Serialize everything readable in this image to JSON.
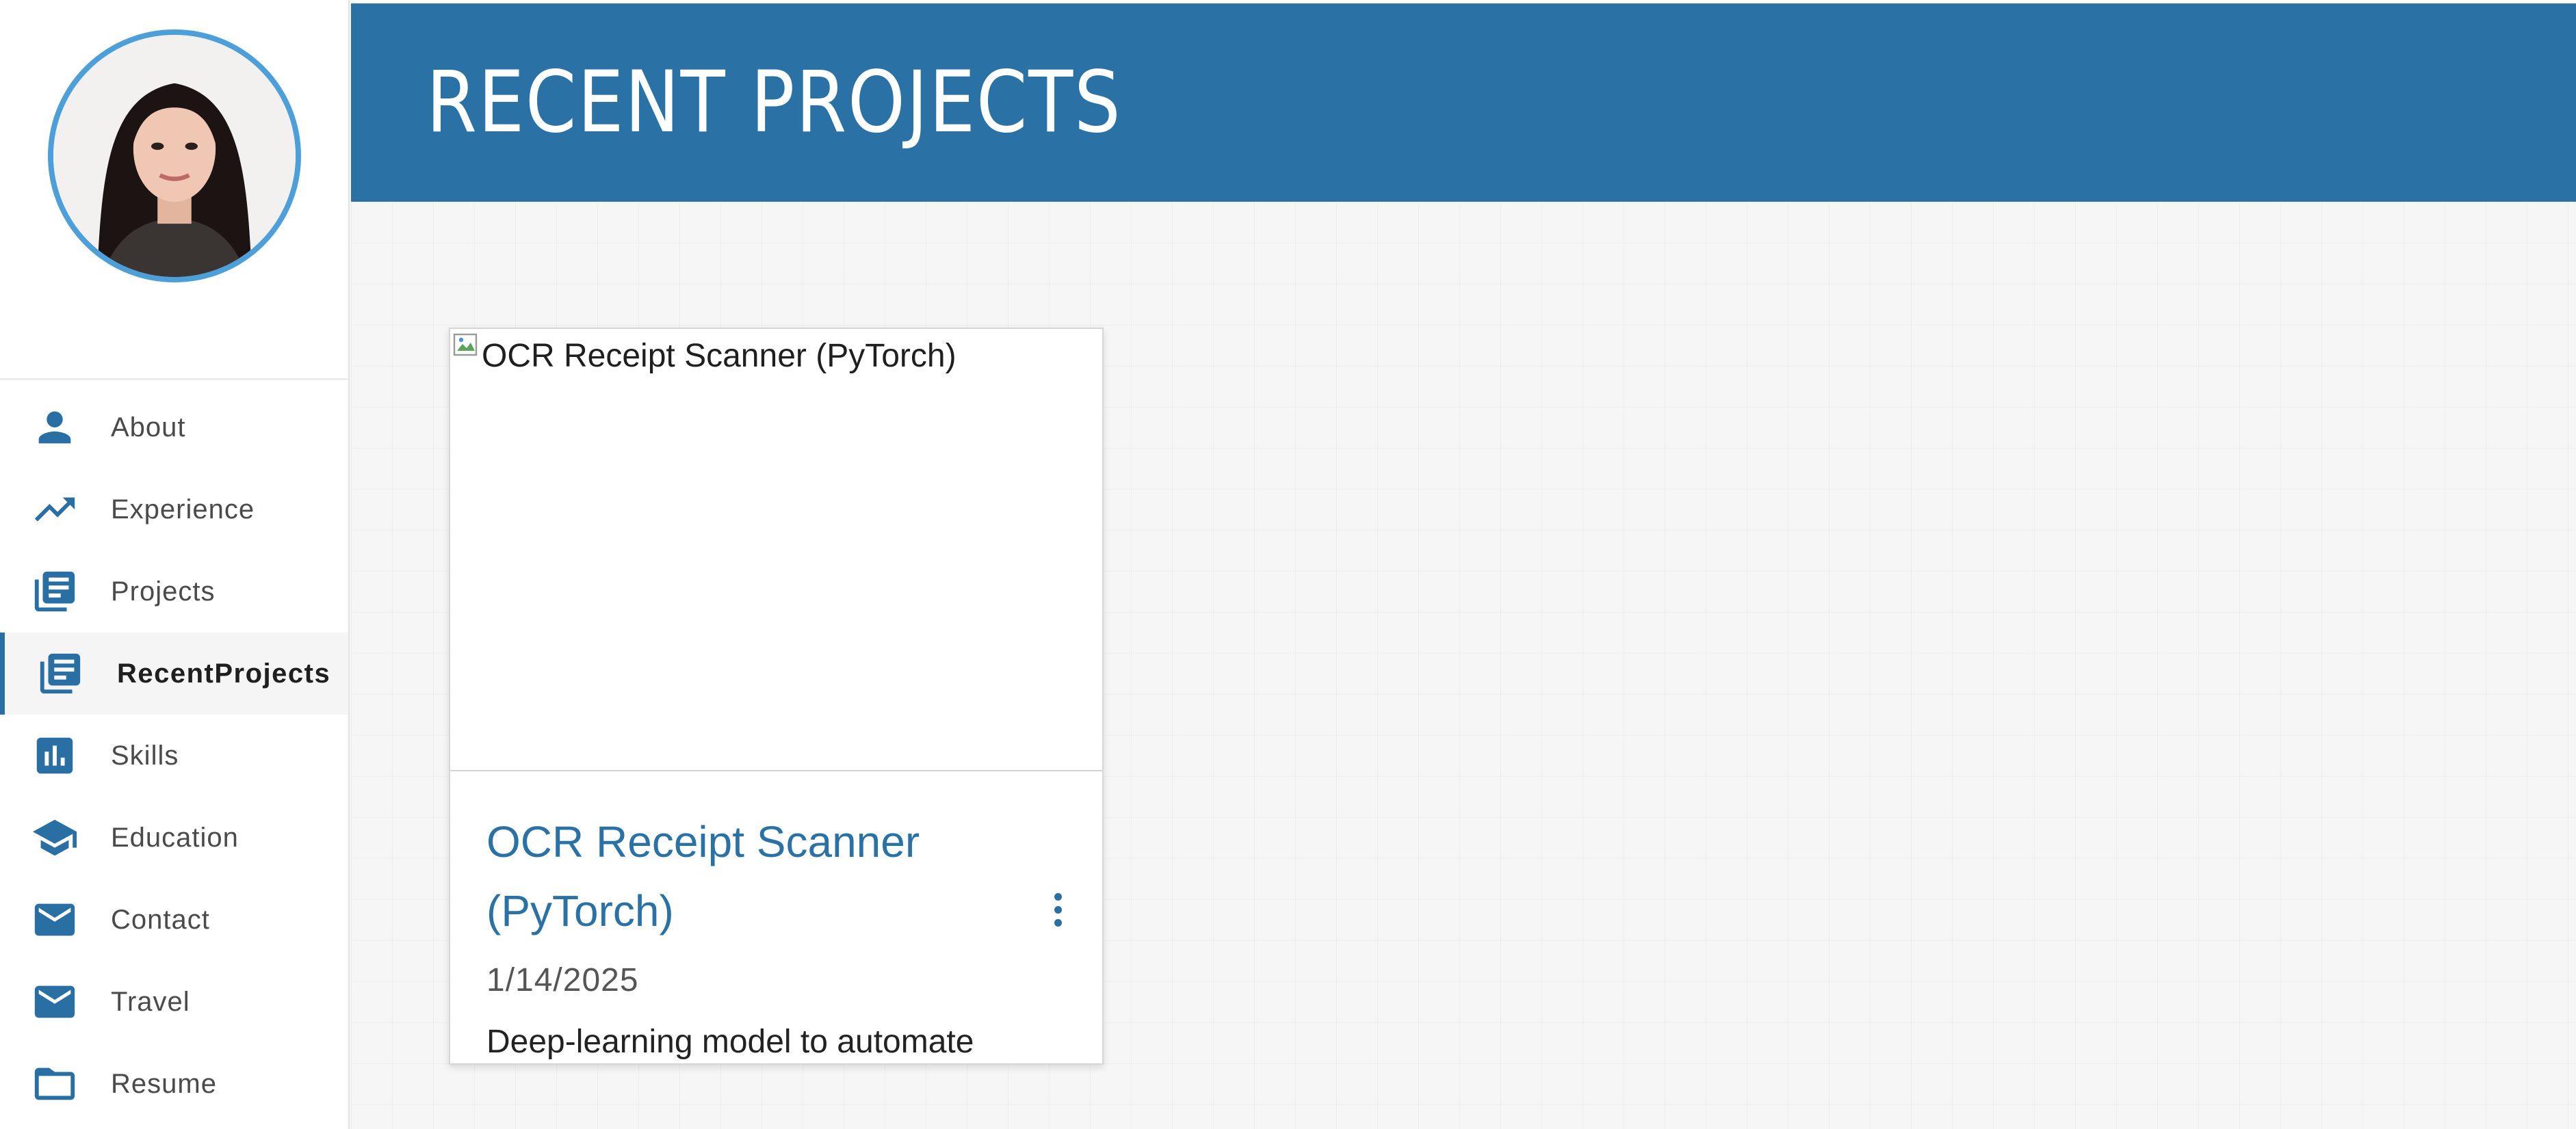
{
  "header": {
    "title": "RECENT PROJECTS"
  },
  "sidebar": {
    "avatar_alt": "Profile photo",
    "items": [
      {
        "label": "About",
        "icon": "person-icon",
        "active": false
      },
      {
        "label": "Experience",
        "icon": "trending-up-icon",
        "active": false
      },
      {
        "label": "Projects",
        "icon": "library-books-icon",
        "active": false
      },
      {
        "label": "RecentProjects",
        "icon": "library-books-icon",
        "active": true
      },
      {
        "label": "Skills",
        "icon": "bar-chart-icon",
        "active": false
      },
      {
        "label": "Education",
        "icon": "graduation-cap-icon",
        "active": false
      },
      {
        "label": "Contact",
        "icon": "mail-icon",
        "active": false
      },
      {
        "label": "Travel",
        "icon": "mail-icon",
        "active": false
      },
      {
        "label": "Resume",
        "icon": "folder-icon",
        "active": false
      }
    ]
  },
  "card": {
    "image_alt": "OCR Receipt Scanner (PyTorch)",
    "title": "OCR Receipt Scanner (PyTorch)",
    "date": "1/14/2025",
    "description": "Deep-learning model to automate",
    "menu_icon": "more-vert-icon"
  },
  "colors": {
    "primary": "#2a72a5",
    "avatar_ring": "#4d9fd9",
    "background": "#f6f6f6"
  }
}
